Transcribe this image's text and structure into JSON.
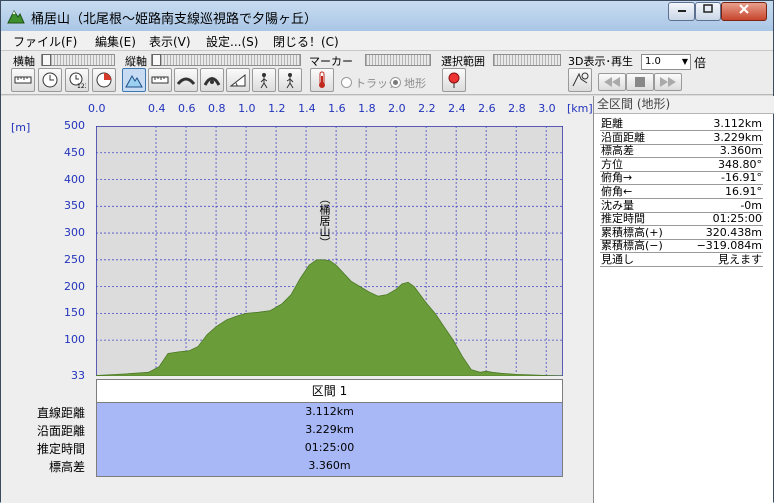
{
  "window": {
    "title": "桶居山（北尾根～姫路南支線巡視路で夕陽ヶ丘）"
  },
  "menu": [
    "ファイル(F)",
    "編集(E)",
    "表示(V)",
    "設定...(S)",
    "閉じる！(C)"
  ],
  "toolbar": {
    "horizontal_axis_label": "横軸",
    "vertical_axis_label": "縦軸",
    "marker_label": "マーカー",
    "range_label": "選択範囲",
    "playback_label": "3D表示･再生",
    "speed_value": "1.0",
    "speed_unit": "倍",
    "radio_track_label": "トラック",
    "radio_terrain_label": "地形",
    "selected_radio": "terrain"
  },
  "chart_data": {
    "type": "area",
    "x_unit": "[km]",
    "y_unit": "[m]",
    "x_ticks": [
      "0.0",
      "0.4",
      "0.6",
      "0.8",
      "1.0",
      "1.2",
      "1.4",
      "1.6",
      "1.8",
      "2.0",
      "2.2",
      "2.4",
      "2.6",
      "2.8",
      "3.0"
    ],
    "y_ticks": [
      "500",
      "450",
      "400",
      "350",
      "300",
      "250",
      "200",
      "150",
      "100",
      "33"
    ],
    "xlim": [
      0,
      3.112
    ],
    "ylim": [
      33,
      500
    ],
    "fill_color": "#6a9c3a",
    "summit_label": "（桶居山）",
    "x": [
      0.0,
      0.2,
      0.35,
      0.42,
      0.48,
      0.55,
      0.62,
      0.68,
      0.74,
      0.8,
      0.87,
      0.94,
      1.0,
      1.08,
      1.16,
      1.24,
      1.3,
      1.36,
      1.42,
      1.47,
      1.52,
      1.56,
      1.6,
      1.65,
      1.7,
      1.76,
      1.82,
      1.88,
      1.94,
      2.0,
      2.04,
      2.08,
      2.12,
      2.16,
      2.2,
      2.26,
      2.32,
      2.38,
      2.44,
      2.5,
      2.56,
      2.6,
      2.64,
      2.7,
      2.8,
      2.9,
      3.0,
      3.112
    ],
    "y": [
      34,
      37,
      40,
      50,
      75,
      78,
      80,
      88,
      110,
      125,
      138,
      145,
      150,
      152,
      155,
      168,
      185,
      215,
      240,
      250,
      250,
      248,
      240,
      225,
      210,
      200,
      190,
      182,
      185,
      195,
      205,
      208,
      200,
      185,
      170,
      150,
      125,
      100,
      70,
      45,
      40,
      42,
      40,
      38,
      36,
      35,
      34,
      33
    ]
  },
  "segment": {
    "header": "区間 1",
    "labels": [
      "直線距離",
      "沿面距離",
      "推定時間",
      "標高差"
    ],
    "values": [
      "3.112km",
      "3.229km",
      "01:25:00",
      "3.360m"
    ]
  },
  "side_panel": {
    "title": "全区間 (地形)",
    "stats": [
      {
        "name": "距離",
        "value": "3.112km"
      },
      {
        "name": "沿面距離",
        "value": "3.229km"
      },
      {
        "name": "標高差",
        "value": "3.360m"
      },
      {
        "name": "方位",
        "value": "348.80°"
      },
      {
        "name": "俯角→",
        "value": "-16.91°"
      },
      {
        "name": "俯角←",
        "value": "16.91°"
      },
      {
        "name": "沈み量",
        "value": "-0m"
      },
      {
        "name": "推定時間",
        "value": "01:25:00"
      },
      {
        "name": "累積標高(+)",
        "value": "320.438m"
      },
      {
        "name": "累積標高(−)",
        "value": "−319.084m"
      },
      {
        "name": "見通し",
        "value": "見えます"
      }
    ]
  }
}
